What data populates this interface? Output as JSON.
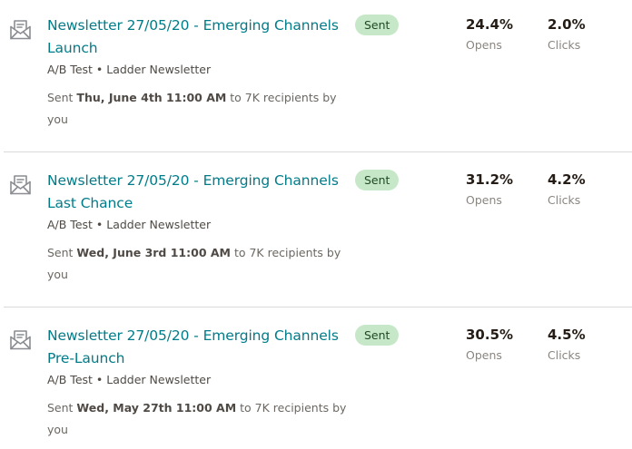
{
  "campaigns": [
    {
      "title": "Newsletter 27/05/20 - Emerging Channels Launch",
      "meta": "A/B Test • Ladder Newsletter",
      "sent_prefix": "Sent ",
      "sent_date": "Thu, June 4th 11:00 AM",
      "sent_suffix": " to 7K recipients by you",
      "status": "Sent",
      "opens_value": "24.4%",
      "opens_label": "Opens",
      "clicks_value": "2.0%",
      "clicks_label": "Clicks",
      "icon": "envelope-open-icon"
    },
    {
      "title": "Newsletter 27/05/20 - Emerging Channels Last Chance",
      "meta": "A/B Test • Ladder Newsletter",
      "sent_prefix": "Sent ",
      "sent_date": "Wed, June 3rd 11:00 AM",
      "sent_suffix": " to 7K recipients by you",
      "status": "Sent",
      "opens_value": "31.2%",
      "opens_label": "Opens",
      "clicks_value": "4.2%",
      "clicks_label": "Clicks",
      "icon": "envelope-open-icon"
    },
    {
      "title": "Newsletter 27/05/20 - Emerging Channels Pre-Launch",
      "meta": "A/B Test • Ladder Newsletter",
      "sent_prefix": "Sent ",
      "sent_date": "Wed, May 27th 11:00 AM",
      "sent_suffix": " to 7K recipients by you",
      "status": "Sent",
      "opens_value": "30.5%",
      "opens_label": "Opens",
      "clicks_value": "4.5%",
      "clicks_label": "Clicks",
      "icon": "envelope-open-icon"
    }
  ],
  "colors": {
    "link": "#007c89",
    "badge_bg": "#c6e8c8",
    "badge_text": "#1f4a24",
    "icon": "#8a8d91"
  }
}
